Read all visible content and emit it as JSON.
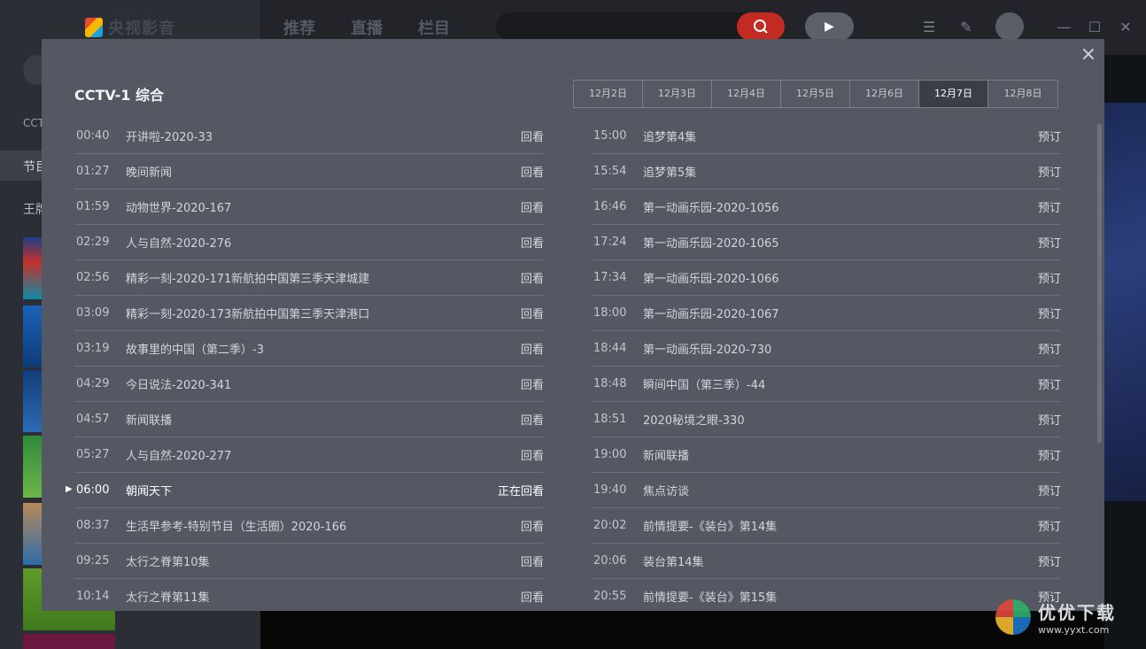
{
  "app": {
    "logo_text": "央视影音",
    "nav": [
      "推荐",
      "直播",
      "栏目"
    ],
    "left_labels": [
      "CCT",
      "节目",
      "王牌"
    ]
  },
  "modal": {
    "channel_title": "CCTV-1 综合",
    "close_symbol": "×",
    "dates": [
      "12月2日",
      "12月3日",
      "12月4日",
      "12月5日",
      "12月6日",
      "12月7日",
      "12月8日"
    ],
    "active_date_index": 5,
    "left_schedule": [
      {
        "time": "00:40",
        "name": "开讲啦-2020-33",
        "action": "回看"
      },
      {
        "time": "01:27",
        "name": "晚间新闻",
        "action": "回看"
      },
      {
        "time": "01:59",
        "name": "动物世界-2020-167",
        "action": "回看"
      },
      {
        "time": "02:29",
        "name": "人与自然-2020-276",
        "action": "回看"
      },
      {
        "time": "02:56",
        "name": "精彩一刻-2020-171新航拍中国第三季天津城建",
        "action": "回看"
      },
      {
        "time": "03:09",
        "name": "精彩一刻-2020-173新航拍中国第三季天津港口",
        "action": "回看"
      },
      {
        "time": "03:19",
        "name": "故事里的中国（第二季）-3",
        "action": "回看"
      },
      {
        "time": "04:29",
        "name": "今日说法-2020-341",
        "action": "回看"
      },
      {
        "time": "04:57",
        "name": "新闻联播",
        "action": "回看"
      },
      {
        "time": "05:27",
        "name": "人与自然-2020-277",
        "action": "回看"
      },
      {
        "time": "06:00",
        "name": "朝闻天下",
        "action": "正在回看",
        "current": true
      },
      {
        "time": "08:37",
        "name": "生活早参考-特别节目（生活圈）2020-166",
        "action": "回看"
      },
      {
        "time": "09:25",
        "name": "太行之脊第10集",
        "action": "回看"
      },
      {
        "time": "10:14",
        "name": "太行之脊第11集",
        "action": "回看"
      }
    ],
    "right_schedule": [
      {
        "time": "15:00",
        "name": "追梦第4集",
        "action": "预订"
      },
      {
        "time": "15:54",
        "name": "追梦第5集",
        "action": "预订"
      },
      {
        "time": "16:46",
        "name": "第一动画乐园-2020-1056",
        "action": "预订"
      },
      {
        "time": "17:24",
        "name": "第一动画乐园-2020-1065",
        "action": "预订"
      },
      {
        "time": "17:34",
        "name": "第一动画乐园-2020-1066",
        "action": "预订"
      },
      {
        "time": "18:00",
        "name": "第一动画乐园-2020-1067",
        "action": "预订"
      },
      {
        "time": "18:44",
        "name": "第一动画乐园-2020-730",
        "action": "预订"
      },
      {
        "time": "18:48",
        "name": "瞬间中国（第三季）-44",
        "action": "预订"
      },
      {
        "time": "18:51",
        "name": "2020秘境之眼-330",
        "action": "预订"
      },
      {
        "time": "19:00",
        "name": "新闻联播",
        "action": "预订"
      },
      {
        "time": "19:40",
        "name": "焦点访谈",
        "action": "预订"
      },
      {
        "time": "20:02",
        "name": "前情提要-《装台》第14集",
        "action": "预订"
      },
      {
        "time": "20:06",
        "name": "装台第14集",
        "action": "预订"
      },
      {
        "time": "20:55",
        "name": "前情提要-《装台》第15集",
        "action": "预订"
      }
    ]
  },
  "watermark": {
    "main": "优优下载",
    "url": "www.yyxt.com"
  },
  "colors": {
    "modal_bg": "#545862",
    "accent_red": "#c32b22",
    "active_tab": "#3b3e46"
  }
}
